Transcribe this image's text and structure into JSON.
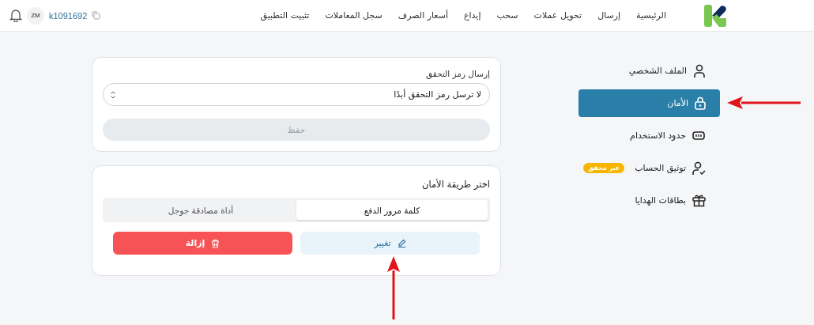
{
  "header": {
    "nav": [
      {
        "label": "الرئيسية"
      },
      {
        "label": "إرسال"
      },
      {
        "label": "تحويل عملات"
      },
      {
        "label": "سحب"
      },
      {
        "label": "إيداع"
      },
      {
        "label": "أسعار الصرف"
      },
      {
        "label": "سجل المعاملات"
      },
      {
        "label": "تثبيت التطبيق"
      }
    ],
    "user": {
      "initials": "ZM",
      "account_id": "k1091692"
    }
  },
  "sidebar": {
    "items": [
      {
        "label": "الملف الشخصي",
        "kind": "user",
        "selected": false
      },
      {
        "label": "الأمان",
        "kind": "lock",
        "selected": true
      },
      {
        "label": "حدود الاستخدام",
        "kind": "battery",
        "selected": false
      },
      {
        "label": "توثيق الحساب",
        "kind": "user-check",
        "selected": false,
        "badge": "غير محقق"
      },
      {
        "label": "بطاقات الهدايا",
        "kind": "gift",
        "selected": false
      }
    ]
  },
  "otp_card": {
    "label": "إرسال رمز التحقق",
    "value": "لا ترسل رمز التحقق أبدًا",
    "save_button": {
      "label": "حفظ",
      "disabled": true
    }
  },
  "method_card": {
    "title": "اختر طريقة الأمان",
    "tabs": [
      {
        "label": "كلمة مرور الدفع",
        "selected": true
      },
      {
        "label": "أداة مصادقة جوجل",
        "selected": false
      }
    ],
    "buttons": [
      {
        "label": "تغيير",
        "kind": "edit"
      },
      {
        "label": "إزالة",
        "kind": "delete"
      }
    ]
  }
}
